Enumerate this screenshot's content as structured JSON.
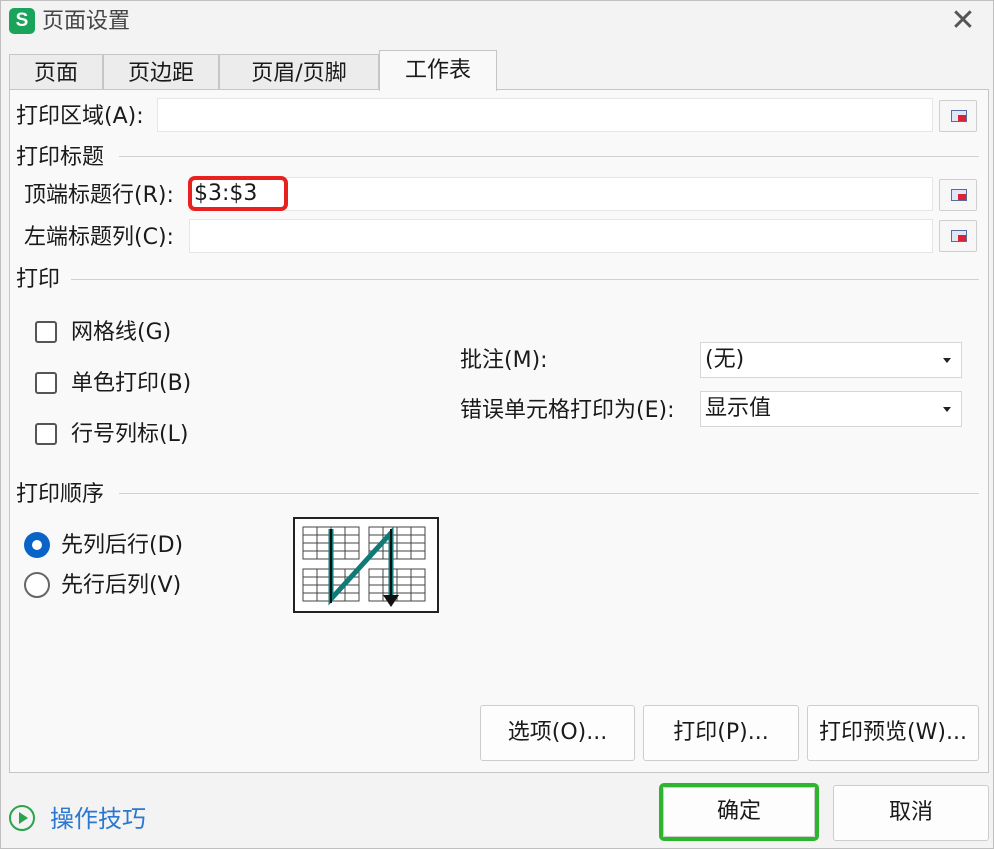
{
  "window": {
    "title": "页面设置",
    "app_icon_letter": "S"
  },
  "tabs": [
    {
      "label": "页面"
    },
    {
      "label": "页边距"
    },
    {
      "label": "页眉/页脚"
    },
    {
      "label": "工作表",
      "active": true
    }
  ],
  "print_area": {
    "label": "打印区域(A):",
    "value": ""
  },
  "print_titles": {
    "section": "打印标题",
    "top_rows_label": "顶端标题行(R):",
    "top_rows_value": "$3:$3",
    "left_cols_label": "左端标题列(C):",
    "left_cols_value": ""
  },
  "print_section": {
    "section": "打印",
    "checkboxes": [
      {
        "label": "网格线(G)",
        "checked": false
      },
      {
        "label": "单色打印(B)",
        "checked": false
      },
      {
        "label": "行号列标(L)",
        "checked": false
      }
    ],
    "comments_label": "批注(M):",
    "comments_value": "(无)",
    "errors_label": "错误单元格打印为(E):",
    "errors_value": "显示值"
  },
  "print_order": {
    "section": "打印顺序",
    "options": [
      {
        "label": "先列后行(D)",
        "checked": true
      },
      {
        "label": "先行后列(V)",
        "checked": false
      }
    ]
  },
  "buttons": {
    "options": "选项(O)...",
    "print": "打印(P)...",
    "preview": "打印预览(W)...",
    "ok": "确定",
    "cancel": "取消"
  },
  "tips": {
    "label": "操作技巧"
  },
  "colors": {
    "accent": "#0a64c8",
    "highlight_red": "#e8201e",
    "highlight_green": "#2eb42e",
    "app_green": "#1aa35a"
  }
}
